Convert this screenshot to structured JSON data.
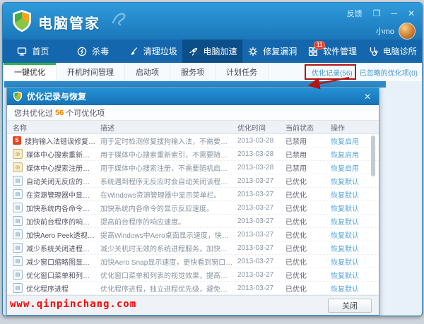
{
  "window": {
    "title": "电脑管家",
    "feedback_label": "反馈",
    "user_name": "小mo",
    "controls": {
      "skin": "❐",
      "minimize": "─",
      "close": "✕"
    }
  },
  "nav": {
    "items": [
      {
        "label": "首页",
        "icon": "home",
        "active": false
      },
      {
        "label": "杀毒",
        "icon": "antivirus",
        "active": false
      },
      {
        "label": "清理垃圾",
        "icon": "clean",
        "active": false
      },
      {
        "label": "电脑加速",
        "icon": "speedup",
        "active": true
      },
      {
        "label": "修复漏洞",
        "icon": "fix",
        "active": false
      },
      {
        "label": "软件管理",
        "icon": "software",
        "active": false,
        "badge": "11"
      },
      {
        "label": "电脑诊所",
        "icon": "clinic",
        "active": false
      }
    ]
  },
  "subtabs": {
    "items": [
      {
        "label": "一键优化",
        "active": true
      },
      {
        "label": "开机时间管理",
        "active": false
      },
      {
        "label": "启动项",
        "active": false
      },
      {
        "label": "服务项",
        "active": false
      },
      {
        "label": "计划任务",
        "active": false
      }
    ],
    "links": [
      {
        "label": "优化记录(56)",
        "highlighted": true
      },
      {
        "label": "已忽略的优化项(0)",
        "highlighted": false
      }
    ]
  },
  "dialog": {
    "title": "优化记录与恢复",
    "close_glyph": "✕",
    "summary": {
      "prefix": "您共优化过",
      "count": "56",
      "suffix": "个可优化项"
    },
    "table": {
      "columns": [
        "名称",
        "描述",
        "优化时间",
        "当前状态",
        "操作"
      ],
      "rows": [
        {
          "icon": "sogou",
          "name": "搜狗输入法错误修复任务",
          "desc": "用于定时检测修复搜狗输入法，不需要自动启动。",
          "time": "2013-03-28",
          "status": "已禁用",
          "action": "恢复启用"
        },
        {
          "icon": "media",
          "name": "媒体中心搜索重新索引任务",
          "desc": "用于媒体中心搜索重新索引，不需要随机启动。",
          "time": "2013-03-28",
          "status": "已禁用",
          "action": "恢复启用"
        },
        {
          "icon": "media",
          "name": "媒体中心搜索注册任务",
          "desc": "用于媒体中心搜索注册，不需要随机启动。",
          "time": "2013-03-28",
          "status": "已禁用",
          "action": "恢复启用"
        },
        {
          "icon": "system",
          "name": "自动关闭无反应的程序",
          "desc": "系统遇到程序无反应时会自动关闭该程序，避免系统...",
          "time": "2013-03-27",
          "status": "已优化",
          "action": "恢复默认"
        },
        {
          "icon": "system",
          "name": "在资源管理器中显示菜单",
          "desc": "在Windows资源管理器中显示菜单栏。",
          "time": "2013-03-27",
          "status": "已优化",
          "action": "恢复默认"
        },
        {
          "icon": "system",
          "name": "加快系统内各命令的显示反应速度",
          "desc": "加快系统内各命令的显示反应速度。",
          "time": "2013-03-27",
          "status": "已优化",
          "action": "恢复默认"
        },
        {
          "icon": "system",
          "name": "加快前台程序的响应速度",
          "desc": "提高前台程序的响应速度。",
          "time": "2013-03-27",
          "status": "已优化",
          "action": "恢复默认"
        },
        {
          "icon": "system",
          "name": "加快Aero Peek透视桌面功能的...",
          "desc": "提高Windows中Aero桌面显示速度，快速切换到任意打...",
          "time": "2013-03-27",
          "status": "已优化",
          "action": "恢复默认"
        },
        {
          "icon": "system",
          "name": "减少系统关闭进程时间",
          "desc": "减少关机时无效的系统进程服务，加快关机速度。",
          "time": "2013-03-27",
          "status": "已优化",
          "action": "恢复默认"
        },
        {
          "icon": "system",
          "name": "减少窗口缩略图显示时间",
          "desc": "加快Aero Snap显示速度，更快看到窗口缩略图(需要重...",
          "time": "2013-03-27",
          "status": "已优化",
          "action": "恢复默认"
        },
        {
          "icon": "system",
          "name": "优化窗口菜单和列表视觉效果",
          "desc": "优化窗口菜单和列表的视觉效果，提高系统运行速度。",
          "time": "2013-03-27",
          "status": "已优化",
          "action": "恢复默认"
        },
        {
          "icon": "system",
          "name": "优化程序进程",
          "desc": "优化程序进程，独立进程优先级，避免系统\"死机\"。",
          "time": "2013-03-27",
          "status": "已优化",
          "action": "恢复默认"
        }
      ]
    },
    "footer": {
      "close_label": "关闭"
    }
  },
  "watermark": "www.qinpinchang.com",
  "colors": {
    "titlebar_blue": "#2592d6",
    "nav_blue": "#1567ad",
    "nav_active_blue": "#0c4e88",
    "tab_green": "#33b24b",
    "badge_red": "#e83b26",
    "link_blue": "#4496d2",
    "count_orange": "#f08200",
    "annotation_red": "#b51212",
    "watermark_red": "#fb0505"
  }
}
